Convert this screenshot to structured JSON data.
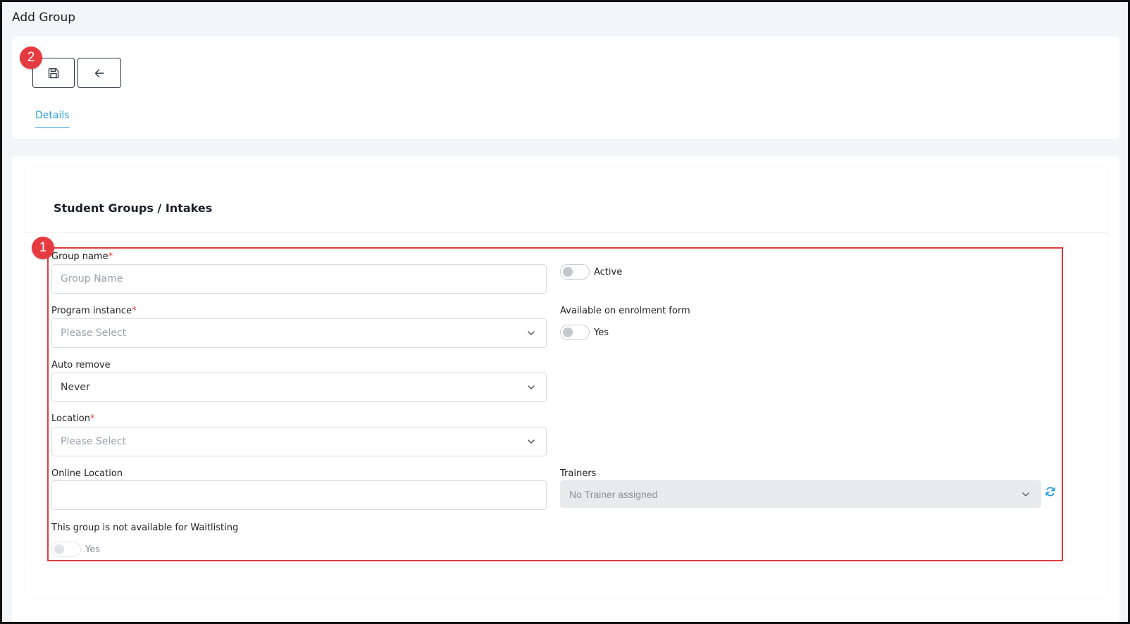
{
  "page_title": "Add Group",
  "toolbar": {
    "save_icon": "save-icon",
    "back_icon": "arrow-left-icon"
  },
  "badges": {
    "toolbar_badge": "2",
    "form_badge": "1"
  },
  "tabs": [
    {
      "label": "Details",
      "active": true
    }
  ],
  "section_title": "Student Groups / Intakes",
  "form": {
    "group_name": {
      "label": "Group name",
      "required": "*",
      "placeholder": "Group Name",
      "value": ""
    },
    "program_instance": {
      "label": "Program instance",
      "required": "*",
      "placeholder": "Please Select"
    },
    "auto_remove": {
      "label": "Auto remove",
      "value": "Never"
    },
    "location": {
      "label": "Location",
      "required": "*",
      "placeholder": "Please Select"
    },
    "online_location": {
      "label": "Online Location",
      "value": ""
    },
    "waitlisting": {
      "label": "This group is not available for Waitlisting",
      "toggle_label": "Yes",
      "on": false
    },
    "active": {
      "toggle_label": "Active",
      "on": false
    },
    "enrolment": {
      "label": "Available on enrolment form",
      "toggle_label": "Yes",
      "on": false
    },
    "trainers": {
      "label": "Trainers",
      "placeholder": "No Trainer assigned",
      "refresh_icon": "refresh-icon"
    }
  },
  "colors": {
    "accent": "#2a9fd8",
    "badge": "#e53a40",
    "highlight": "#e03c3c",
    "required": "#e53a40"
  }
}
